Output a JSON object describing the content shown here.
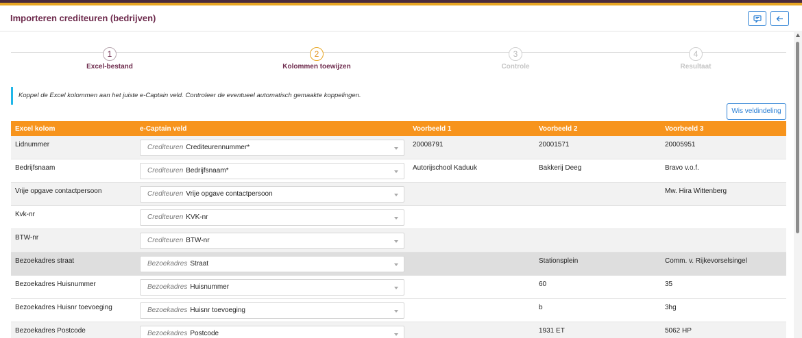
{
  "window": {
    "title": "Importeren crediteuren (bedrijven)"
  },
  "icons": {
    "comment": "comment-icon",
    "back": "arrow-left-icon"
  },
  "steps": [
    {
      "num": "1",
      "label": "Excel-bestand",
      "state": "done"
    },
    {
      "num": "2",
      "label": "Kolommen toewijzen",
      "state": "active"
    },
    {
      "num": "3",
      "label": "Controle",
      "state": "future"
    },
    {
      "num": "4",
      "label": "Resultaat",
      "state": "future"
    }
  ],
  "info_text": "Koppel de Excel kolommen aan het juiste e-Captain veld. Controleer de eventueel automatisch gemaakte koppelingen.",
  "wis_button": "Wis veldindeling",
  "table": {
    "headers": [
      "Excel kolom",
      "e-Captain veld",
      "Voorbeeld 1",
      "Voorbeeld 2",
      "Voorbeeld 3"
    ],
    "rows": [
      {
        "excel": "Lidnummer",
        "group": "Crediteuren",
        "field": "Crediteurennummer*",
        "v1": "20008791",
        "v2": "20001571",
        "v3": "20005951"
      },
      {
        "excel": "Bedrijfsnaam",
        "group": "Crediteuren",
        "field": "Bedrijfsnaam*",
        "v1": "Autorijschool Kaduuk",
        "v2": "Bakkerij Deeg",
        "v3": "Bravo v.o.f."
      },
      {
        "excel": "Vrije opgave contactpersoon",
        "group": "Crediteuren",
        "field": "Vrije opgave contactpersoon",
        "v1": "",
        "v2": "",
        "v3": "Mw. Hira Wittenberg"
      },
      {
        "excel": "Kvk-nr",
        "group": "Crediteuren",
        "field": "KVK-nr",
        "v1": "",
        "v2": "",
        "v3": ""
      },
      {
        "excel": "BTW-nr",
        "group": "Crediteuren",
        "field": "BTW-nr",
        "v1": "",
        "v2": "",
        "v3": ""
      },
      {
        "excel": "Bezoekadres straat",
        "group": "Bezoekadres",
        "field": "Straat",
        "v1": "",
        "v2": "Stationsplein",
        "v3": "Comm. v. Rijkevorselsingel"
      },
      {
        "excel": "Bezoekadres Huisnummer",
        "group": "Bezoekadres",
        "field": "Huisnummer",
        "v1": "",
        "v2": "60",
        "v3": "35"
      },
      {
        "excel": "Bezoekadres Huisnr toevoeging",
        "group": "Bezoekadres",
        "field": "Huisnr toevoeging",
        "v1": "",
        "v2": "b",
        "v3": "3hg"
      },
      {
        "excel": "Bezoekadres Postcode",
        "group": "Bezoekadres",
        "field": "Postcode",
        "v1": "",
        "v2": "1931 ET",
        "v3": "5062 HP"
      }
    ]
  }
}
